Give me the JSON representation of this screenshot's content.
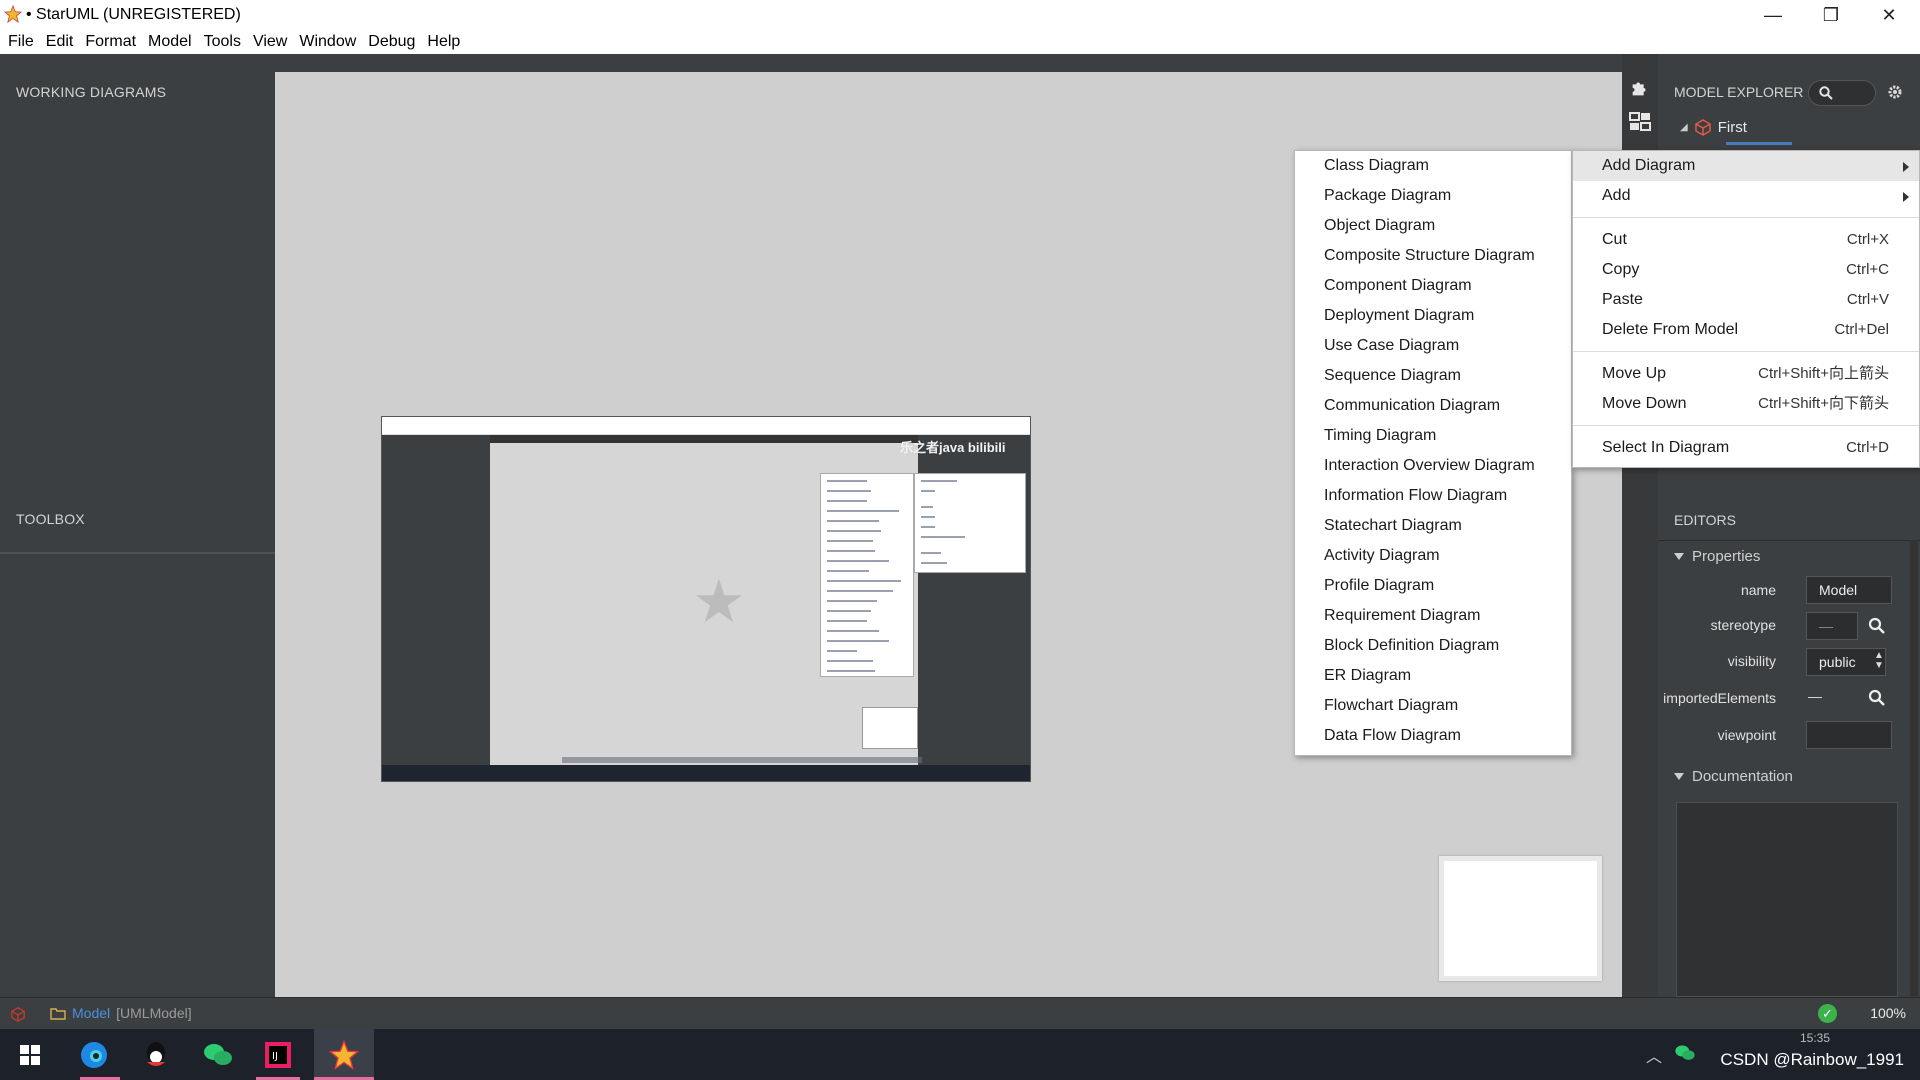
{
  "window": {
    "title": "• StarUML (UNREGISTERED)",
    "controls": [
      "—",
      "❐",
      "✕"
    ]
  },
  "menubar": [
    "File",
    "Edit",
    "Format",
    "Model",
    "Tools",
    "View",
    "Window",
    "Debug",
    "Help"
  ],
  "left": {
    "working_diagrams_header": "WORKING DIAGRAMS",
    "toolbox_header": "TOOLBOX"
  },
  "embedded_video": {
    "watermark": "乐之者java bilibili"
  },
  "model_explorer": {
    "header": "MODEL EXPLORER",
    "tree_item": "First"
  },
  "add_diagram_menu": [
    "Class Diagram",
    "Package Diagram",
    "Object Diagram",
    "Composite Structure Diagram",
    "Component Diagram",
    "Deployment Diagram",
    "Use Case Diagram",
    "Sequence Diagram",
    "Communication Diagram",
    "Timing Diagram",
    "Interaction Overview Diagram",
    "Information Flow Diagram",
    "Statechart Diagram",
    "Activity Diagram",
    "Profile Diagram",
    "Requirement Diagram",
    "Block Definition Diagram",
    "ER Diagram",
    "Flowchart Diagram",
    "Data Flow Diagram"
  ],
  "context_menu": {
    "add_diagram": "Add Diagram",
    "add": "Add",
    "cut": {
      "label": "Cut",
      "shortcut": "Ctrl+X"
    },
    "copy": {
      "label": "Copy",
      "shortcut": "Ctrl+C"
    },
    "paste": {
      "label": "Paste",
      "shortcut": "Ctrl+V"
    },
    "delete": {
      "label": "Delete From Model",
      "shortcut": "Ctrl+Del"
    },
    "move_up": {
      "label": "Move Up",
      "shortcut": "Ctrl+Shift+向上箭头"
    },
    "move_down": {
      "label": "Move Down",
      "shortcut": "Ctrl+Shift+向下箭头"
    },
    "select_in_diagram": {
      "label": "Select In Diagram",
      "shortcut": "Ctrl+D"
    }
  },
  "editors": {
    "header": "EDITORS",
    "properties_section": "Properties",
    "name_label": "name",
    "name_value": "Model",
    "stereotype_label": "stereotype",
    "stereotype_value": "—",
    "visibility_label": "visibility",
    "visibility_value": "public",
    "imported_label": "importedElements",
    "imported_value": "—",
    "viewpoint_label": "viewpoint",
    "viewpoint_value": "",
    "documentation_section": "Documentation"
  },
  "statusbar": {
    "model": "Model",
    "model_type": "[UMLModel]",
    "zoom": "100%"
  },
  "taskbar": {
    "tray_text": "CSDN @Rainbow_1991",
    "time": "15:35"
  },
  "colors": {
    "panel_bg": "#3c3f41",
    "canvas_bg": "#cfcfcf",
    "accent_blue": "#4a8fdd",
    "ok_green": "#3bb34a"
  }
}
